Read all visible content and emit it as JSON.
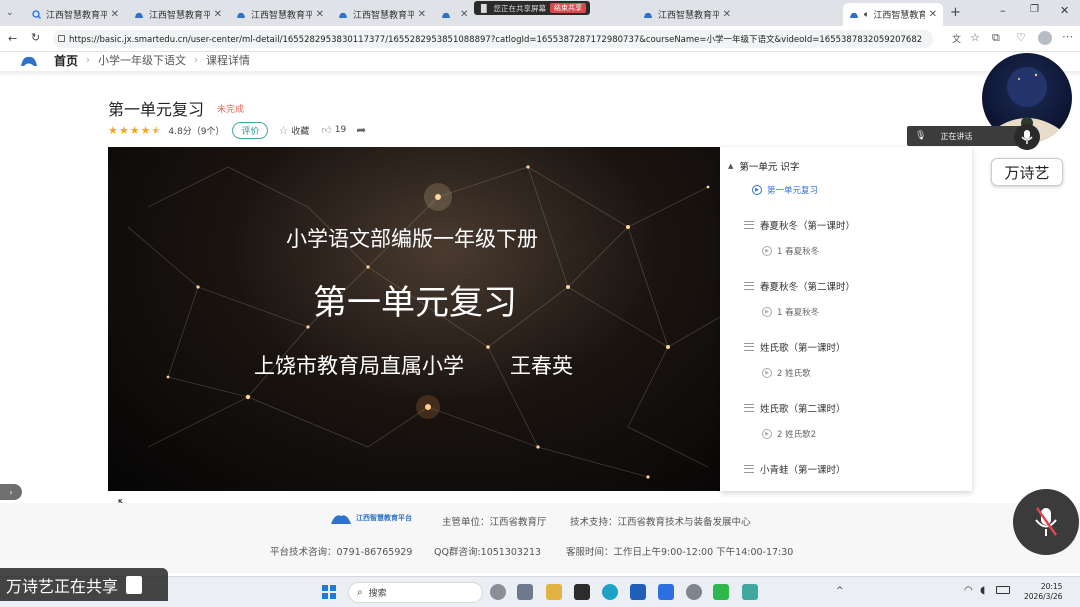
{
  "browser": {
    "tabs": [
      {
        "label": "江西智慧教育平台",
        "icon": "search-icon",
        "active": false
      },
      {
        "label": "江西智慧教育平台",
        "icon": "cloud-icon",
        "active": false
      },
      {
        "label": "江西智慧教育平台",
        "icon": "cloud-icon",
        "active": false
      },
      {
        "label": "江西智慧教育平台",
        "icon": "cloud-icon",
        "active": false
      },
      {
        "label": "江西智慧教育平台",
        "icon": "cloud-icon",
        "active": false
      },
      {
        "label": "江西智慧教育平台",
        "icon": "cloud-icon",
        "active": false
      },
      {
        "label": "江西智慧教育平台",
        "icon": "cloud-icon",
        "active": true
      }
    ],
    "share_indicator": {
      "text": "您正在共享屏幕",
      "end_label": "结束共享"
    },
    "url": "https://basic.jx.smartedu.cn/user-center/ml-detail/1655282953830117377/1655282953851088897?catlogId=1655387287172980737&courseName=小学一年级下语文&videoId=1655387832059207682"
  },
  "breadcrumb": {
    "home": "首页",
    "course": "小学一年级下语文",
    "detail": "课程详情"
  },
  "course": {
    "title": "第一单元复习",
    "status": "未完成",
    "rating_text": "4.8分（9个）",
    "rating_stars": 4.5,
    "rate_label": "评价",
    "favorite_label": "收藏",
    "like_count": "19"
  },
  "video": {
    "subtitle": "小学语文部编版一年级下册",
    "title": "第一单元复习",
    "school": "上饶市教育局直属小学",
    "teacher": "王春英"
  },
  "playlist": {
    "unit_title": "第一单元 识字",
    "items": [
      {
        "type": "lesson",
        "label": "第一单元复习",
        "current": true
      },
      {
        "type": "chapter",
        "label": "春夏秋冬（第一课时）"
      },
      {
        "type": "lesson",
        "label": "1 春夏秋冬",
        "current": false
      },
      {
        "type": "chapter",
        "label": "春夏秋冬（第二课时）"
      },
      {
        "type": "lesson",
        "label": "1 春夏秋冬",
        "current": false
      },
      {
        "type": "chapter",
        "label": "姓氏歌（第一课时）"
      },
      {
        "type": "lesson",
        "label": "2 姓氏歌",
        "current": false
      },
      {
        "type": "chapter",
        "label": "姓氏歌（第二课时）"
      },
      {
        "type": "lesson",
        "label": "2 姓氏歌2",
        "current": false
      },
      {
        "type": "chapter",
        "label": "小青蛙（第一课时）"
      }
    ]
  },
  "footer": {
    "logo_text": "江西智慧教育平台",
    "sponsor": "主管单位：江西省教育厅",
    "tech_support": "技术支持：江西省教育技术与装备发展中心",
    "tech_phone": "平台技术咨询：0791-86765929",
    "qq_group": "QQ群咨询:1051303213",
    "service_hours": "客服时间：工作日上午9:00-12:00 下午14:00-17:30"
  },
  "meeting": {
    "sharing_banner": "万诗艺正在共享",
    "speaking_label": "正在讲话",
    "participant_name": "万诗艺"
  },
  "taskbar": {
    "search_placeholder": "搜索",
    "time": "20:15",
    "date": "2026/3/26"
  },
  "colors": {
    "accent_teal": "#2f8f88",
    "status_red": "#e06a58",
    "link_blue": "#2f6fd8",
    "star": "#f2a51d"
  }
}
